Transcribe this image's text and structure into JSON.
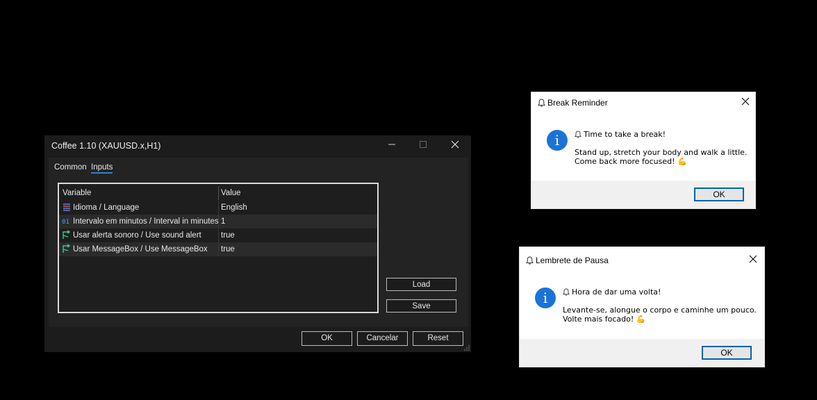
{
  "properties_dialog": {
    "title": "Coffee 1.10 (XAUUSD.x,H1)",
    "controls": {
      "minimize": "—",
      "maximize": "☐",
      "close": "✕"
    },
    "tabs": [
      {
        "label": "Common",
        "active": false
      },
      {
        "label": "Inputs",
        "active": true
      }
    ],
    "grid": {
      "headers": {
        "variable": "Variable",
        "value": "Value"
      },
      "rows": [
        {
          "icon": "list-icon",
          "variable": "Idioma / Language",
          "value": "English"
        },
        {
          "icon": "integer-icon",
          "variable": "Intervalo em minutos / Interval in minutes",
          "value": "1"
        },
        {
          "icon": "boolean-arrow-icon",
          "variable": "Usar alerta sonoro / Use sound alert",
          "value": "true"
        },
        {
          "icon": "boolean-arrow-icon",
          "variable": "Usar MessageBox / Use MessageBox",
          "value": "true"
        }
      ]
    },
    "side_buttons": {
      "load": "Load",
      "save": "Save"
    },
    "footer_buttons": {
      "ok": "OK",
      "cancel": "Cancelar",
      "reset": "Reset"
    }
  },
  "message_box_en": {
    "title": "Break Reminder",
    "headline": "Time to take a break!",
    "line1": "Stand up, stretch your body and walk a little.",
    "line2": "Come back more focused! 💪",
    "ok": "OK"
  },
  "message_box_pt": {
    "title": "Lembrete de Pausa",
    "headline": "Hora de dar uma volta!",
    "line1": "Levante-se, alongue o corpo e caminhe um pouco.",
    "line2": "Volte mais focado! 💪",
    "ok": "OK"
  },
  "colors": {
    "dialog_bg": "#1c1c1c",
    "accent_blue": "#2e7fd6",
    "info_icon_blue": "#1b73d8",
    "ok_focus_border": "#0063b1"
  }
}
